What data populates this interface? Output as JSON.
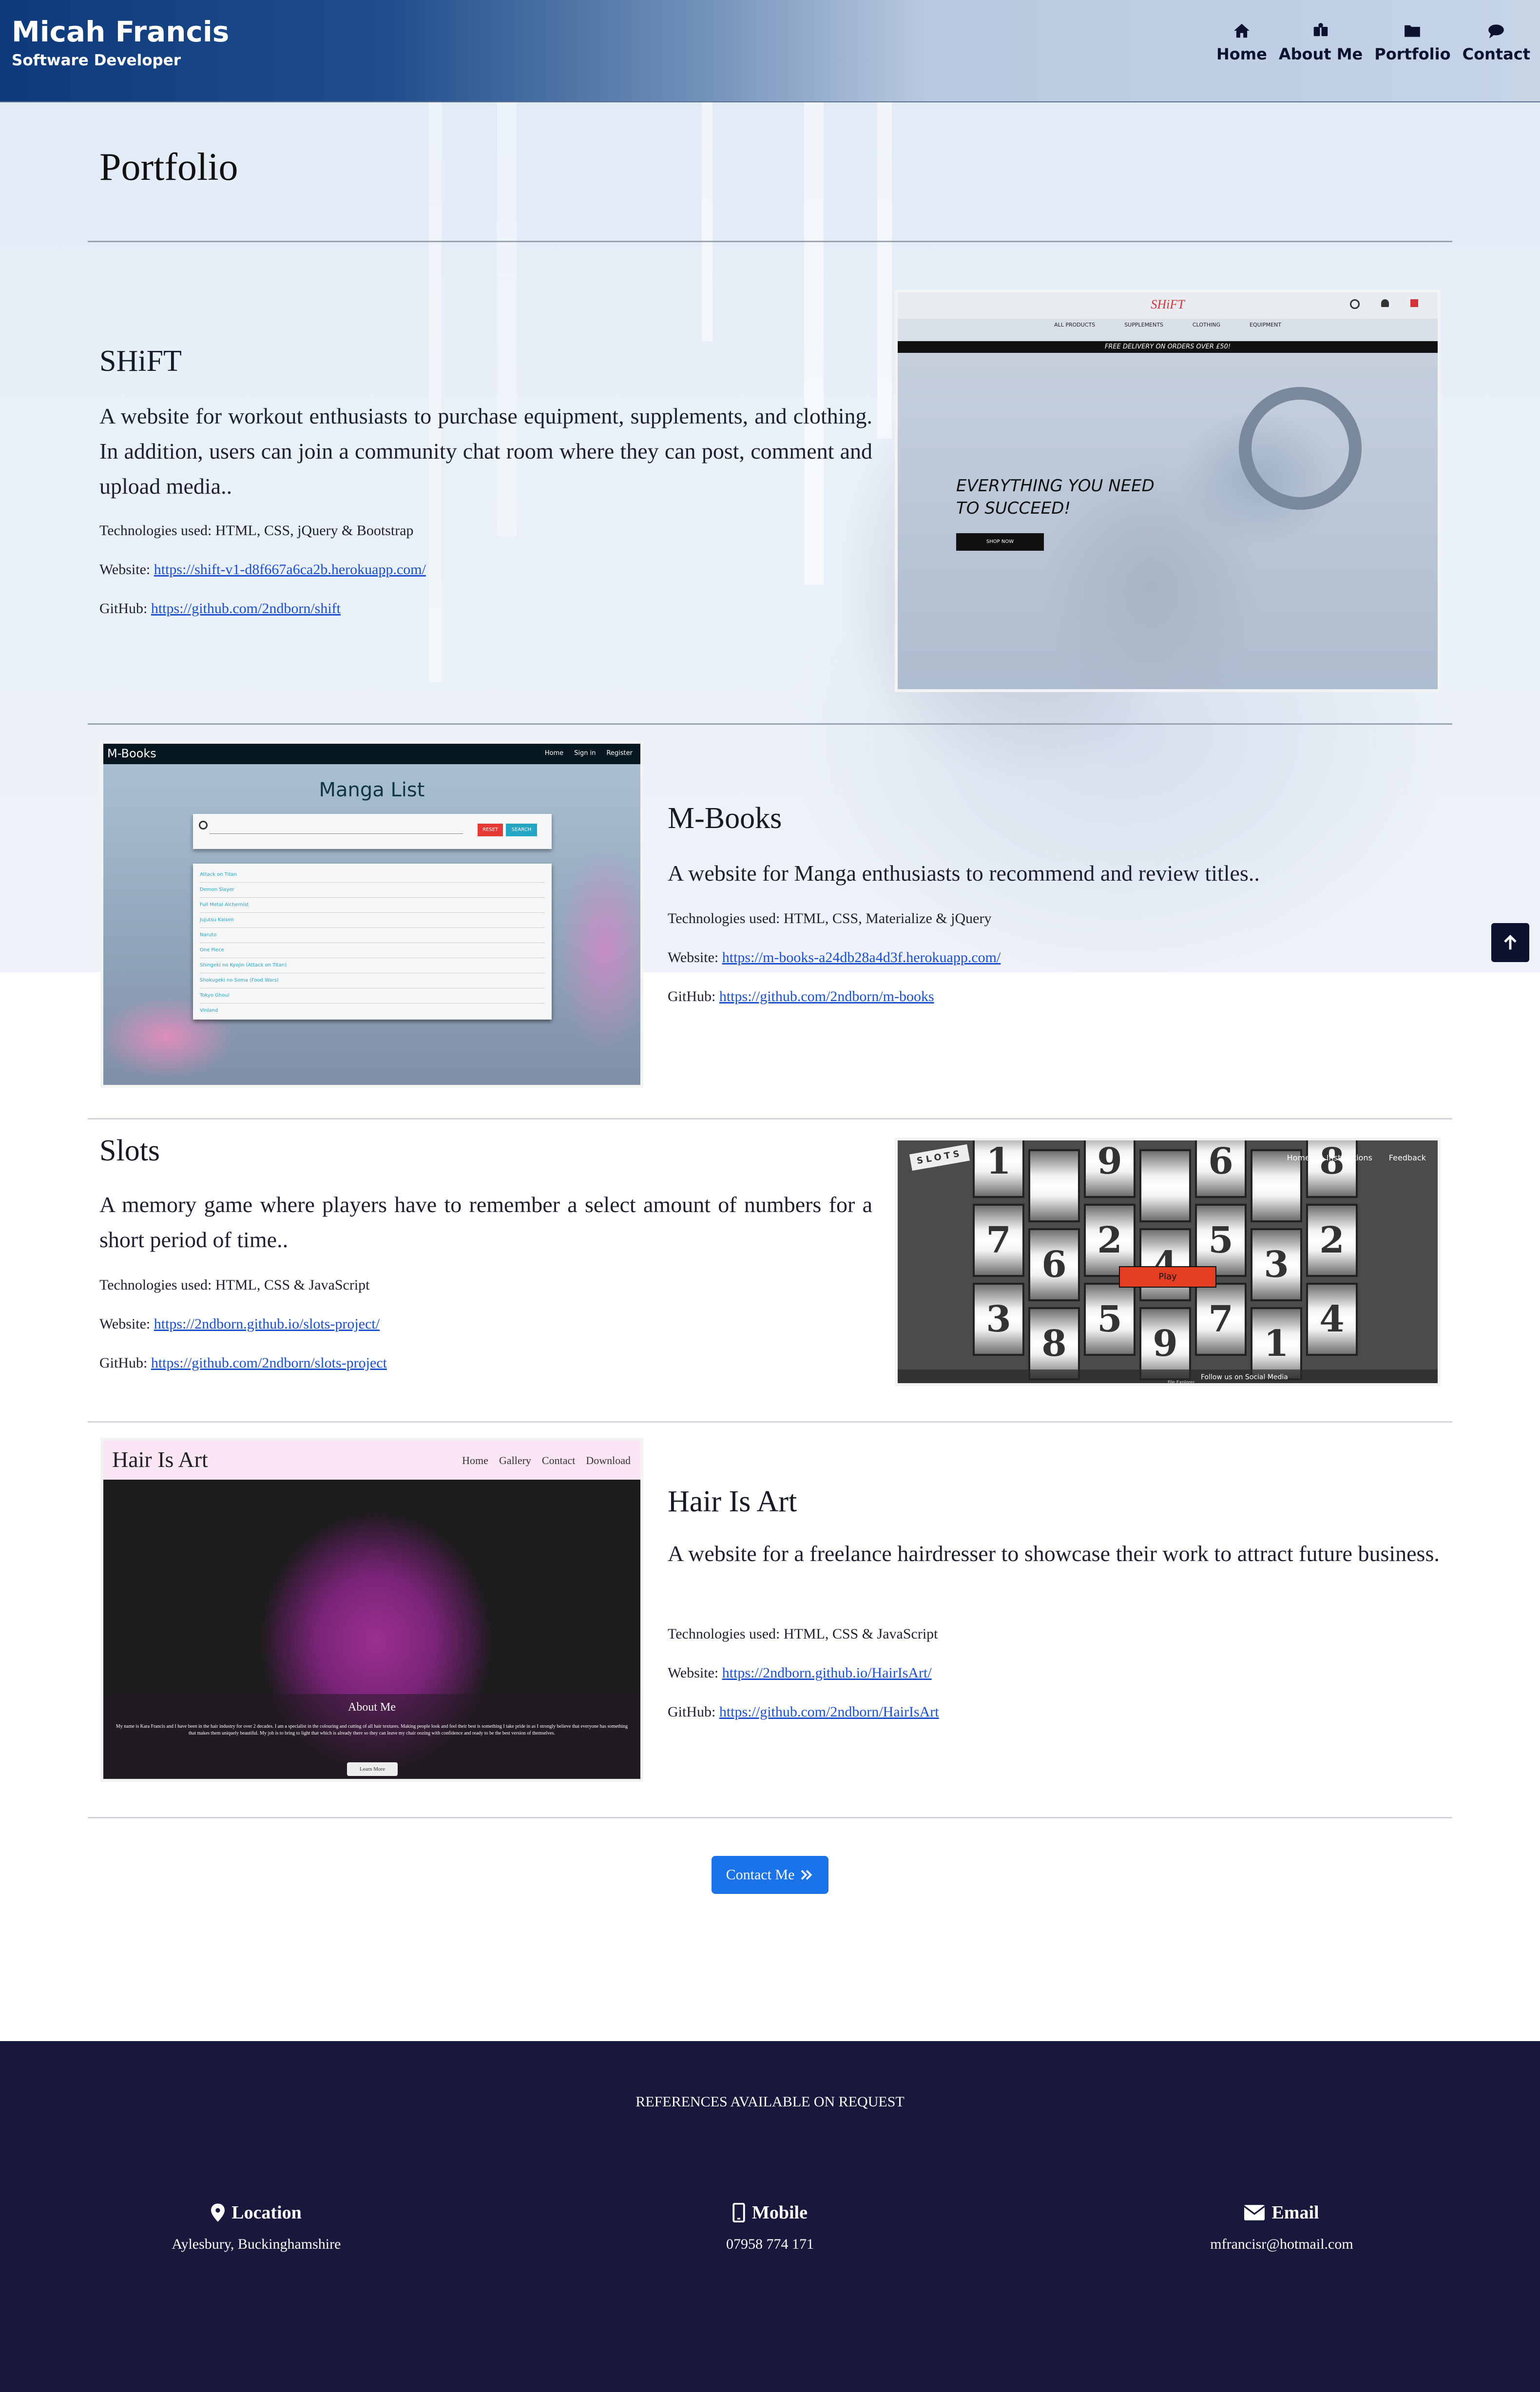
{
  "header": {
    "name": "Micah Francis",
    "subtitle": "Software Developer",
    "nav": [
      {
        "label": "Home",
        "icon": "home-icon"
      },
      {
        "label": "About Me",
        "icon": "about-icon"
      },
      {
        "label": "Portfolio",
        "icon": "folder-icon"
      },
      {
        "label": "Contact",
        "icon": "chat-icon"
      }
    ]
  },
  "page": {
    "title": "Portfolio"
  },
  "projects": [
    {
      "title": "SHiFT",
      "description": "A website for workout enthusiasts to purchase equipment, supplements, and clothing. In addition, users can join a community chat room where they can post, comment and upload media..",
      "tech": "Technologies used: HTML, CSS, jQuery & Bootstrap",
      "website_label": "Website: ",
      "website": "https://shift-v1-d8f667a6ca2b.herokuapp.com/",
      "github_label": "GitHub: ",
      "github": "https://github.com/2ndborn/shift",
      "shot": {
        "logo": "SHiFT",
        "menu": [
          "ALL PRODUCTS",
          "SUPPLEMENTS",
          "CLOTHING",
          "EQUIPMENT"
        ],
        "banner": "FREE DELIVERY ON ORDERS OVER £50!",
        "headline": "EVERYTHING YOU NEED TO SUCCEED!",
        "cta": "SHOP NOW"
      }
    },
    {
      "title": "M-Books",
      "description": "A website for Manga enthusiasts to recommend and review titles..",
      "tech": "Technologies used: HTML, CSS, Materialize & jQuery",
      "website_label": "Website: ",
      "website": "https://m-books-a24db28a4d3f.herokuapp.com/",
      "github_label": "GitHub: ",
      "github": "https://github.com/2ndborn/m-books",
      "shot": {
        "logo": "M-Books",
        "nav": [
          "Home",
          "Sign in",
          "Register"
        ],
        "heading": "Manga List",
        "reset": "RESET",
        "search": "SEARCH",
        "items": [
          "Attack on Titan",
          "Demon Slayer",
          "Full Metal Alchemist",
          "Jujutsu Kaisen",
          "Naruto",
          "One Piece",
          "Shingeki no Kyojin (Attack on Titan)",
          "Shokugeki no Soma (Food Wars)",
          "Tokyo Ghoul",
          "Vinland"
        ]
      }
    },
    {
      "title": "Slots",
      "description": "A memory game where players have to remember a select amount of numbers for a short period of time..",
      "tech": "Technologies used: HTML, CSS & JavaScript",
      "website_label": "Website: ",
      "website": "https://2ndborn.github.io/slots-project/",
      "github_label": "GitHub: ",
      "github": "https://github.com/2ndborn/slots-project",
      "shot": {
        "logo": "SLOTS",
        "nav": [
          "Home",
          "Instructions",
          "Feedback"
        ],
        "play": "Play",
        "social": "Follow us on Social Media",
        "credit": "File Explorer",
        "columns": [
          [
            "1",
            "7",
            "3"
          ],
          [
            "",
            "6",
            "8"
          ],
          [
            "9",
            "2",
            "5"
          ],
          [
            "",
            "4",
            "9"
          ],
          [
            "6",
            "5",
            "7"
          ],
          [
            "",
            "3",
            "1"
          ],
          [
            "8",
            "2",
            "4"
          ]
        ]
      }
    },
    {
      "title": "Hair Is Art",
      "description": "A website for a freelance hairdresser to showcase their work to attract future business.",
      "tech": "Technologies used: HTML, CSS & JavaScript",
      "website_label": "Website: ",
      "website": "https://2ndborn.github.io/HairIsArt/",
      "github_label": "GitHub: ",
      "github": "https://github.com/2ndborn/HairIsArt",
      "shot": {
        "logo": "Hair Is Art",
        "nav": [
          "Home",
          "Gallery",
          "Contact",
          "Download"
        ],
        "about_title": "About Me",
        "about_text": "My name is Kara Francis and I have been in the hair industry for over 2 decades. I am a specialist in the colouring and cutting of all hair textures. Making people look and feel their best is something I take pride in as I strongly believe that everyone has something that makes them uniquely beautiful. My job is to bring to light that which is already there so they can leave my chair oozing with confidence and ready to be the best version of themselves.",
        "button": "Learn More"
      }
    }
  ],
  "contact_button": "Contact Me",
  "footer": {
    "references": "REFERENCES AVAILABLE ON REQUEST",
    "location_label": "Location",
    "location": "Aylesbury, Buckinghamshire",
    "mobile_label": "Mobile",
    "mobile": "07958 774 171",
    "email_label": "Email",
    "email": "mfrancisr@hotmail.com"
  },
  "colors": {
    "navy": "#0c1230",
    "footer": "#18183d",
    "accent": "#1a73e8",
    "link": "#1a4fd0"
  }
}
